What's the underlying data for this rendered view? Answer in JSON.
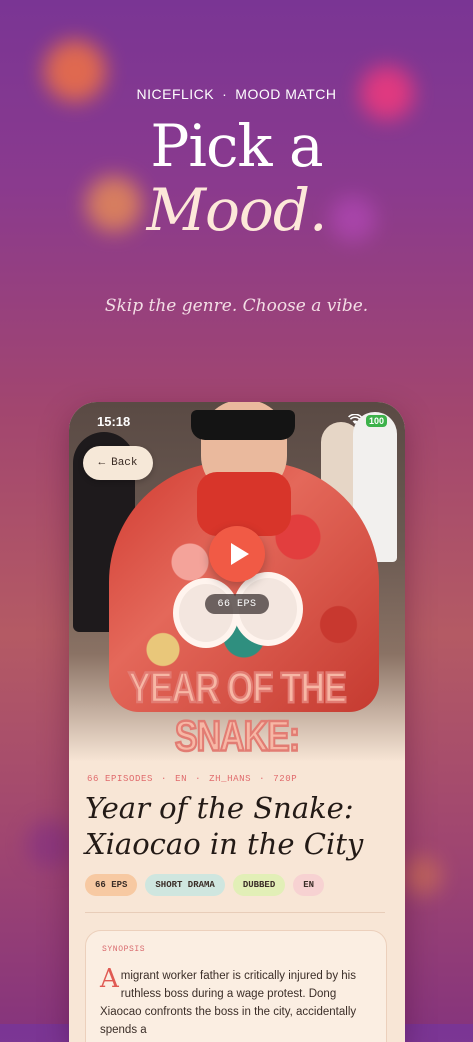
{
  "header": {
    "brand": "NICEFLICK",
    "separator": "·",
    "section": "MOOD MATCH",
    "title_line1": "Pick a",
    "title_line2": "Mood.",
    "tagline": "Skip the genre. Choose a vibe."
  },
  "phone": {
    "status": {
      "time": "15:18",
      "wifi_icon": "wifi-icon",
      "battery": "100"
    },
    "back_button": {
      "icon": "back-arrow-icon",
      "label": "Back"
    },
    "play_icon": "play-icon",
    "episodes_pill": "66 EPS",
    "poster_title": "YEAR OF THE SNAKE:",
    "meta": [
      "66 EPISODES",
      "EN",
      "ZH_HANS",
      "720P"
    ],
    "meta_separator": "·",
    "title": "Year of the Snake: Xiaocao in the City",
    "tags": [
      "66 EPS",
      "SHORT DRAMA",
      "DUBBED",
      "EN"
    ],
    "synopsis": {
      "label": "SYNOPSIS",
      "drop_cap": "A",
      "text": " migrant worker father is critically injured by his ruthless boss during a wage protest. Dong Xiaocao confronts the boss in the city, accidentally spends a"
    }
  },
  "colors": {
    "play_button": "#f15a45",
    "meta_text": "#e06a6c",
    "tag_eps": "#f7c9a2",
    "tag_short_drama": "#cfe6df",
    "tag_dubbed": "#e2efb7",
    "tag_en": "#f7d2d2"
  }
}
